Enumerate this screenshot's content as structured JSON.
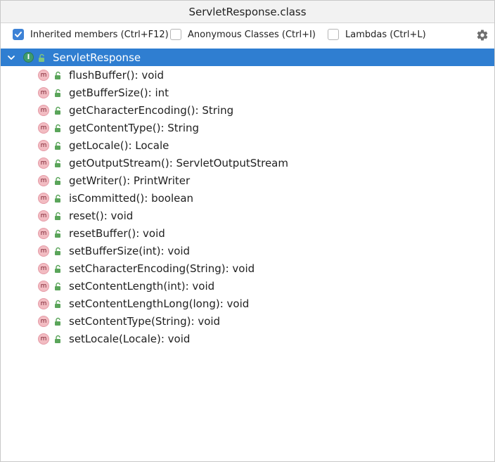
{
  "window": {
    "title": "ServletResponse.class"
  },
  "toolbar": {
    "options": [
      {
        "label": "Inherited members (Ctrl+F12)",
        "checked": true
      },
      {
        "label": "Anonymous Classes (Ctrl+I)",
        "checked": false
      },
      {
        "label": "Lambdas (Ctrl+L)",
        "checked": false
      }
    ],
    "settings_icon": "gear-icon"
  },
  "tree": {
    "root": {
      "label": "ServletResponse",
      "kind_badge": "I",
      "expanded": true
    },
    "member_badge": "m",
    "members": [
      "flushBuffer(): void",
      "getBufferSize(): int",
      "getCharacterEncoding(): String",
      "getContentType(): String",
      "getLocale(): Locale",
      "getOutputStream(): ServletOutputStream",
      "getWriter(): PrintWriter",
      "isCommitted(): boolean",
      "reset(): void",
      "resetBuffer(): void",
      "setBufferSize(int): void",
      "setCharacterEncoding(String): void",
      "setContentLength(int): void",
      "setContentLengthLong(long): void",
      "setContentType(String): void",
      "setLocale(Locale): void"
    ]
  },
  "colors": {
    "selection": "#2f7ed1",
    "checkbox_checked": "#3d82d6",
    "interface_badge": "#3f9c6e",
    "method_badge": "#f2bcc2",
    "lock_green": "#5aa55a"
  }
}
